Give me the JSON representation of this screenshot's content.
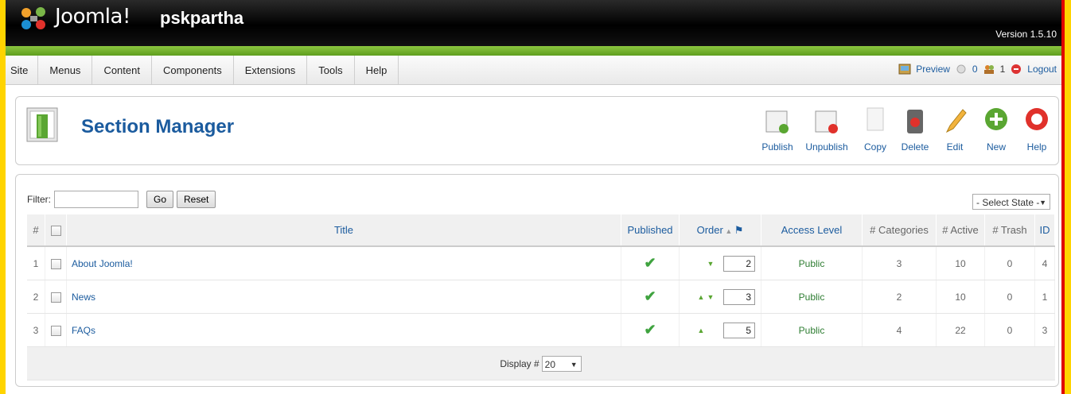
{
  "header": {
    "brand": "Joomla!",
    "site_name": "pskpartha",
    "version": "Version 1.5.10"
  },
  "menu": [
    "Site",
    "Menus",
    "Content",
    "Components",
    "Extensions",
    "Tools",
    "Help"
  ],
  "status": {
    "preview": "Preview",
    "messages": "0",
    "users": "1",
    "logout": "Logout"
  },
  "page": {
    "title": "Section Manager"
  },
  "toolbar": {
    "publish": "Publish",
    "unpublish": "Unpublish",
    "copy": "Copy",
    "delete": "Delete",
    "edit": "Edit",
    "new": "New",
    "help": "Help"
  },
  "filter": {
    "label": "Filter:",
    "value": "",
    "go": "Go",
    "reset": "Reset",
    "state": "- Select State -"
  },
  "table": {
    "headers": {
      "num": "#",
      "title": "Title",
      "published": "Published",
      "order": "Order",
      "access": "Access Level",
      "categories": "# Categories",
      "active": "# Active",
      "trash": "# Trash",
      "id": "ID"
    },
    "rows": [
      {
        "num": "1",
        "title": "About Joomla!",
        "order": "2",
        "access": "Public",
        "categories": "3",
        "active": "10",
        "trash": "0",
        "id": "4"
      },
      {
        "num": "2",
        "title": "News",
        "order": "3",
        "access": "Public",
        "categories": "2",
        "active": "10",
        "trash": "0",
        "id": "1"
      },
      {
        "num": "3",
        "title": "FAQs",
        "order": "5",
        "access": "Public",
        "categories": "4",
        "active": "22",
        "trash": "0",
        "id": "3"
      }
    ],
    "display_label": "Display #",
    "display_value": "20"
  },
  "colors": {
    "accent": "#1b5b9e",
    "green_bar": "#6aad2a",
    "outer_frame": "#ffd400",
    "red_edge": "#e00000"
  }
}
